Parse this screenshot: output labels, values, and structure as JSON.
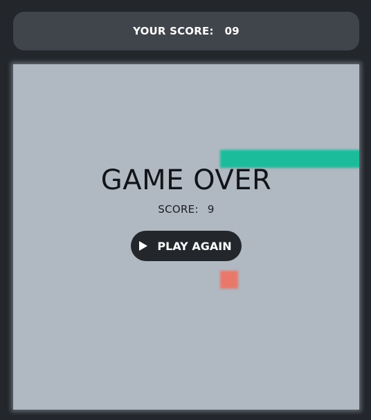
{
  "header": {
    "score_label": "YOUR SCORE:",
    "score_value": "09"
  },
  "overlay": {
    "title": "GAME OVER",
    "score_label": "SCORE:",
    "score_value": "9",
    "play_again_label": "PLAY AGAIN",
    "play_icon": "play-icon"
  },
  "colors": {
    "background": "#23272c",
    "score_bar": "#40444b",
    "board": "#b0b8c2",
    "snake": "#1abc9c",
    "food": "#e9786b"
  }
}
